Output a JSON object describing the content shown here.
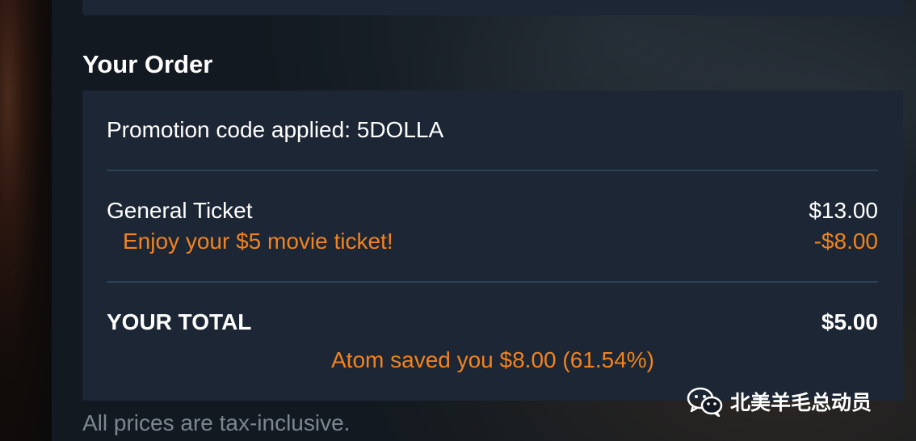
{
  "order": {
    "title": "Your Order",
    "promo_applied": "Promotion code applied: 5DOLLA",
    "line_items": [
      {
        "label": "General Ticket",
        "amount": "$13.00"
      }
    ],
    "discount": {
      "label": "Enjoy your $5 movie ticket!",
      "amount": "-$8.00"
    },
    "total_label": "YOUR TOTAL",
    "total_value": "$5.00",
    "savings_text": "Atom saved you $8.00 (61.54%)"
  },
  "footer": {
    "tax_note": "All prices are tax-inclusive."
  },
  "watermark": {
    "text": "北美羊毛总动员",
    "icon": "wechat-icon"
  },
  "colors": {
    "accent_orange": "#f2831f",
    "card_bg": "#1c2634",
    "divider": "#2e4155",
    "muted_text": "#7c8791"
  }
}
